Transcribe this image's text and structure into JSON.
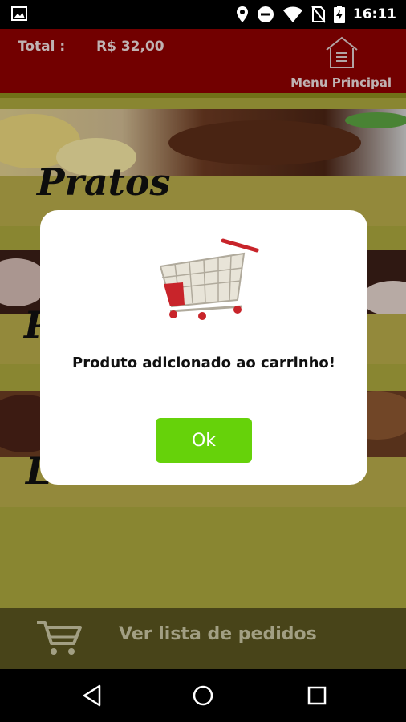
{
  "status_bar": {
    "time": "16:11",
    "icons": [
      "gallery-icon",
      "location-icon",
      "do-not-disturb-icon",
      "wifi-icon",
      "no-sim-icon",
      "battery-charging-icon"
    ]
  },
  "header": {
    "total_label": "Total :",
    "total_value": "R$ 32,00",
    "menu_label": "Menu Principal",
    "menu_icon": "home-menu-icon"
  },
  "categories": [
    {
      "label": "Pratos",
      "icon": "food-photo"
    },
    {
      "label": "P",
      "icon": "food-photo"
    },
    {
      "label": "L",
      "icon": "food-photo"
    }
  ],
  "dialog": {
    "message": "Produto adicionado ao carrinho!",
    "ok_label": "Ok",
    "image": "shopping-cart-image"
  },
  "order_bar": {
    "label": "Ver lista de pedidos",
    "icon": "cart-icon"
  },
  "nav_bar": {
    "buttons": [
      "back-icon",
      "home-icon",
      "recents-icon"
    ]
  },
  "colors": {
    "header_bg": "#8b0000",
    "content_bg": "#a8a43c",
    "order_bar_bg": "#58541f",
    "ok_button": "#66d20a"
  }
}
